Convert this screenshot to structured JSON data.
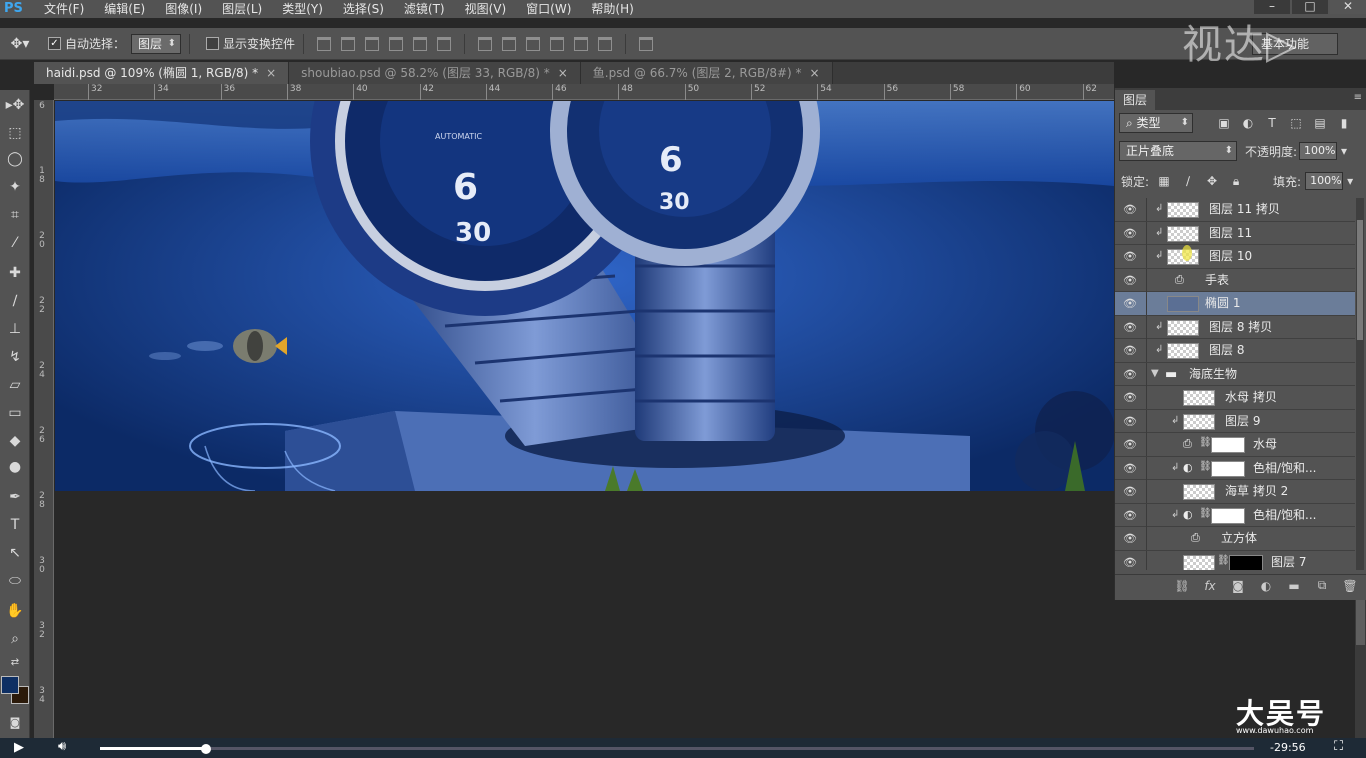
{
  "app": {
    "logo": "PS"
  },
  "menu": [
    "文件(F)",
    "编辑(E)",
    "图像(I)",
    "图层(L)",
    "类型(Y)",
    "选择(S)",
    "滤镜(T)",
    "视图(V)",
    "窗口(W)",
    "帮助(H)"
  ],
  "window_controls": [
    "–",
    "□",
    "✕"
  ],
  "options": {
    "auto_select_label": "自动选择：",
    "auto_select_target": "图层",
    "show_transform_label": "显示变换控件",
    "workspace": "基本功能"
  },
  "tabs": [
    {
      "label": "haidi.psd @ 109% (椭圆 1, RGB/8) *",
      "close": "×",
      "active": true
    },
    {
      "label": "shoubiao.psd @ 58.2% (图层 33, RGB/8) *",
      "close": "×",
      "active": false
    },
    {
      "label": "鱼.psd @ 66.7% (图层 2, RGB/8#) *",
      "close": "×",
      "active": false
    }
  ],
  "ruler": {
    "h": [
      "32",
      "34",
      "36",
      "38",
      "40",
      "42",
      "44",
      "46",
      "48",
      "50",
      "52",
      "54",
      "56",
      "58",
      "60",
      "62"
    ],
    "v": [
      "6",
      "1 8",
      "2 0",
      "2 2",
      "2 4",
      "2 6",
      "2 8",
      "3 0",
      "3 2",
      "3 4"
    ]
  },
  "layers_panel": {
    "title": "图层",
    "filter": "类型",
    "blend_mode": "正片叠底",
    "opacity_label": "不透明度:",
    "opacity": "100%",
    "lock_label": "锁定:",
    "fill_label": "填充:",
    "fill": "100%",
    "layers": [
      {
        "name": "图层 11 拷贝",
        "kind": "pixel",
        "clip": true,
        "indent": 0
      },
      {
        "name": "图层 11",
        "kind": "pixel",
        "clip": true,
        "indent": 0
      },
      {
        "name": "图层 10",
        "kind": "pixel",
        "clip": true,
        "indent": 0
      },
      {
        "name": "手表",
        "kind": "smart",
        "clip": false,
        "indent": 0
      },
      {
        "name": "椭圆 1",
        "kind": "shape",
        "clip": false,
        "indent": 0,
        "selected": true
      },
      {
        "name": "图层 8 拷贝",
        "kind": "pixel",
        "clip": true,
        "indent": 0
      },
      {
        "name": "图层 8",
        "kind": "pixel",
        "clip": true,
        "indent": 0
      },
      {
        "name": "海底生物",
        "kind": "group",
        "clip": false,
        "indent": 0
      },
      {
        "name": "水母 拷贝",
        "kind": "pixel",
        "clip": false,
        "indent": 1
      },
      {
        "name": "图层 9",
        "kind": "pixel",
        "clip": true,
        "indent": 1
      },
      {
        "name": "水母",
        "kind": "smart-mask",
        "clip": false,
        "indent": 1
      },
      {
        "name": "色相/饱和...",
        "kind": "adjust",
        "clip": true,
        "indent": 1
      },
      {
        "name": "海草 拷贝 2",
        "kind": "pixel",
        "clip": false,
        "indent": 1
      },
      {
        "name": "色相/饱和...",
        "kind": "adjust",
        "clip": true,
        "indent": 1
      },
      {
        "name": "立方体",
        "kind": "smart",
        "clip": false,
        "indent": 1
      },
      {
        "name": "图层 7",
        "kind": "pixel-mask",
        "clip": false,
        "indent": 1
      }
    ]
  },
  "video": {
    "time": "-29:56",
    "progress": 0.092
  },
  "watermarks": {
    "shijue": "视达▷",
    "dawu": "大吴号",
    "dawu_url": "www.dawuhao.com"
  },
  "colors": {
    "foreground": "#0e2f63",
    "background": "#2b1a0a",
    "selection": "#6b7d99"
  }
}
